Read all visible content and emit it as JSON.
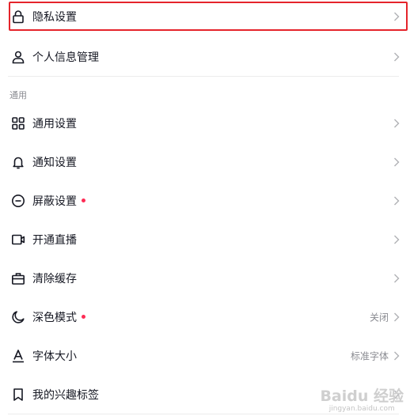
{
  "settings": {
    "items_top": [
      {
        "label": "隐私设置",
        "icon": "lock-icon",
        "highlighted": true
      },
      {
        "label": "个人信息管理",
        "icon": "person-icon"
      }
    ],
    "section_general": {
      "title": "通用",
      "items": [
        {
          "label": "通用设置",
          "icon": "grid-icon"
        },
        {
          "label": "通知设置",
          "icon": "bell-icon"
        },
        {
          "label": "屏蔽设置",
          "icon": "block-icon",
          "badge_dot": true
        },
        {
          "label": "开通直播",
          "icon": "video-icon"
        },
        {
          "label": "清除缓存",
          "icon": "briefcase-icon"
        },
        {
          "label": "深色模式",
          "icon": "moon-icon",
          "badge_dot": true,
          "value": "关闭"
        },
        {
          "label": "字体大小",
          "icon": "font-size-icon",
          "value": "标准字体"
        },
        {
          "label": "我的兴趣标签",
          "icon": "bookmark-icon"
        }
      ]
    }
  },
  "watermark": {
    "main": "Baidu 经验",
    "sub": "jingyan.baidu.com"
  },
  "colors": {
    "highlight_border": "#e5242b",
    "badge_dot": "#fe2c55",
    "text_primary": "#161823",
    "text_secondary": "#8a8b91"
  }
}
